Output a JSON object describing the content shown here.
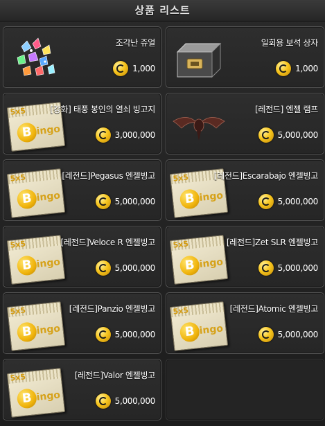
{
  "window": {
    "title": "상품 리스트"
  },
  "items": [
    {
      "name": "조각난 쥬얼",
      "price": "1,000",
      "icon": "jewel-shards-icon"
    },
    {
      "name": "일회용 보석 상자",
      "price": "1,000",
      "icon": "jewel-box-icon"
    },
    {
      "name": "[강화] 태풍 봉인의 열쇠 빙고지",
      "price": "3,000,000",
      "icon": "bingo-ticket-icon"
    },
    {
      "name": "[레전드] 엔젤 램프",
      "price": "5,000,000",
      "icon": "angel-lamp-wings-icon"
    },
    {
      "name": "[레전드]Pegasus 엔젤빙고",
      "price": "5,000,000",
      "icon": "bingo-ticket-icon"
    },
    {
      "name": "[레전드]Escarabajo 엔젤빙고",
      "price": "5,000,000",
      "icon": "bingo-ticket-icon"
    },
    {
      "name": "[레전드]Veloce R 엔젤빙고",
      "price": "5,000,000",
      "icon": "bingo-ticket-icon"
    },
    {
      "name": "[레전드]Zet SLR 엔젤빙고",
      "price": "5,000,000",
      "icon": "bingo-ticket-icon"
    },
    {
      "name": "[레전드]Panzio 엔젤빙고",
      "price": "5,000,000",
      "icon": "bingo-ticket-icon"
    },
    {
      "name": "[레전드]Atomic 엔젤빙고",
      "price": "5,000,000",
      "icon": "bingo-ticket-icon"
    },
    {
      "name": "[레전드]Valor 엔젤빙고",
      "price": "5,000,000",
      "icon": "bingo-ticket-icon"
    }
  ],
  "ticket": {
    "grid_label": "5x5",
    "b_letter": "B",
    "ingo": "ingo"
  },
  "colors": {
    "coin": "#f7c51e",
    "card_border": "#555555",
    "background": "#1d1d1d"
  }
}
